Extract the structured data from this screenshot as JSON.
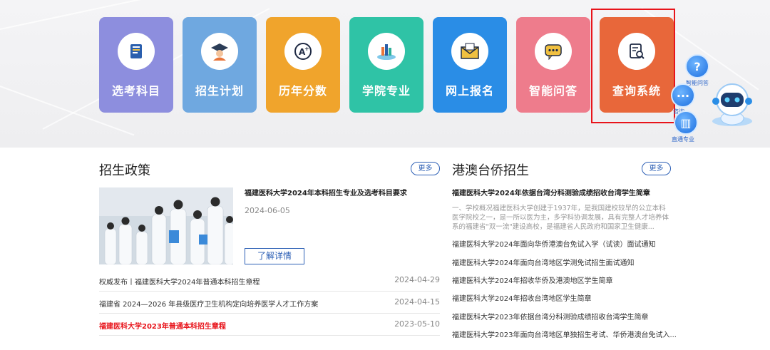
{
  "tiles": [
    {
      "label": "选考科目",
      "color": "#8d8ede",
      "icon": "book-icon"
    },
    {
      "label": "招生计划",
      "color": "#6fa8e0",
      "icon": "graduate-icon"
    },
    {
      "label": "历年分数",
      "color": "#f0a42c",
      "icon": "grade-a-plus-icon"
    },
    {
      "label": "学院专业",
      "color": "#2fc3a6",
      "icon": "campus-icon"
    },
    {
      "label": "网上报名",
      "color": "#2a8de6",
      "icon": "envelope-icon"
    },
    {
      "label": "智能问答",
      "color": "#ee7c8c",
      "icon": "chat-icon"
    },
    {
      "label": "查询系统",
      "color": "#e8673a",
      "icon": "search-doc-icon"
    }
  ],
  "floating": {
    "smart_qa": "智能问答",
    "consult": "咨询",
    "direct_major": "直通专业"
  },
  "policy": {
    "title": "招生政策",
    "more": "更多",
    "featured": {
      "title": "福建医科大学2024年本科招生专业及选考科目要求",
      "date": "2024-06-05",
      "detail_label": "了解详情"
    },
    "list": [
      {
        "title": "权威发布丨福建医科大学2024年普通本科招生章程",
        "date": "2024-04-29",
        "highlight": false
      },
      {
        "title": "福建省 2024—2026 年县级医疗卫生机构定向培养医学人才工作方案",
        "date": "2024-04-15",
        "highlight": false
      },
      {
        "title": "福建医科大学2023年普通本科招生章程",
        "date": "2023-05-10",
        "highlight": true
      }
    ]
  },
  "hkmt": {
    "title": "港澳台侨招生",
    "more": "更多",
    "featured_title": "福建医科大学2024年依据台湾分科测验成绩招收台湾学生简章",
    "summary": "一、学校概况福建医科大学创建于1937年，是我国建校较早的公立本科医学院校之一，是一所以医为主，多学科协调发展，具有完整人才培养体系的福建省\"双一流\"建设高校，是福建省人民政府和国家卫生健康...",
    "list": [
      "福建医科大学2024年面向华侨港澳台免试入学（试读）面试通知",
      "福建医科大学2024年面向台湾地区学测免试招生面试通知",
      "福建医科大学2024年招收华侨及港澳地区学生简章",
      "福建医科大学2024年招收台湾地区学生简章",
      "福建医科大学2023年依据台湾分科测验成绩招收台湾学生简章",
      "福建医科大学2023年面向台湾地区单独招生考试、华侨港澳台免试入..."
    ]
  },
  "colors": {
    "accent_blue": "#2c5fb5",
    "highlight_red": "#e8141b"
  }
}
